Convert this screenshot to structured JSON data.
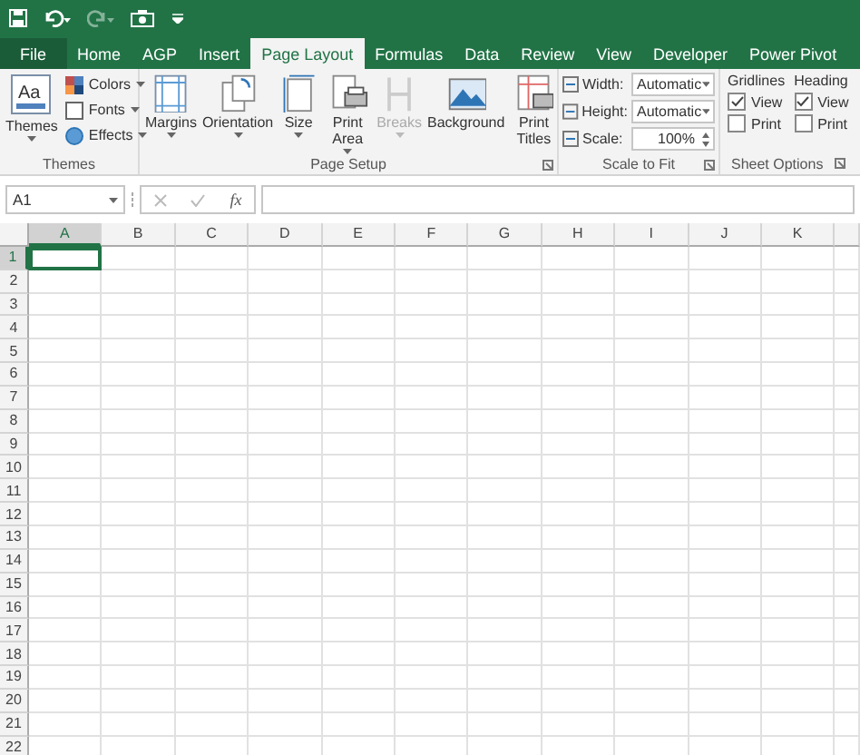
{
  "tabs": [
    {
      "label": "File",
      "kind": "file",
      "selected": false
    },
    {
      "label": "Home",
      "kind": "tab",
      "selected": false
    },
    {
      "label": "AGP",
      "kind": "tab",
      "selected": false
    },
    {
      "label": "Insert",
      "kind": "tab",
      "selected": false
    },
    {
      "label": "Page Layout",
      "kind": "tab",
      "selected": true
    },
    {
      "label": "Formulas",
      "kind": "tab",
      "selected": false
    },
    {
      "label": "Data",
      "kind": "tab",
      "selected": false
    },
    {
      "label": "Review",
      "kind": "tab",
      "selected": false
    },
    {
      "label": "View",
      "kind": "tab",
      "selected": false
    },
    {
      "label": "Developer",
      "kind": "tab",
      "selected": false
    },
    {
      "label": "Power Pivot",
      "kind": "tab",
      "selected": false
    }
  ],
  "themes_group": {
    "label": "Themes",
    "big_button": {
      "label": "Themes",
      "icon_text": "Aa"
    },
    "small_buttons": [
      {
        "label": "Colors"
      },
      {
        "label": "Fonts"
      },
      {
        "label": "Effects"
      }
    ]
  },
  "page_setup_group": {
    "label": "Page Setup",
    "buttons": [
      {
        "label": "Margins",
        "disabled": false,
        "dropdown": true,
        "wrap": false
      },
      {
        "label": "Orientation",
        "disabled": false,
        "dropdown": true,
        "wrap": false
      },
      {
        "label": "Size",
        "disabled": false,
        "dropdown": true,
        "wrap": false
      },
      {
        "label": "Print Area",
        "disabled": false,
        "dropdown": true,
        "wrap": true
      },
      {
        "label": "Breaks",
        "disabled": true,
        "dropdown": true,
        "wrap": false
      },
      {
        "label": "Background",
        "disabled": false,
        "dropdown": false,
        "wrap": false
      },
      {
        "label": "Print Titles",
        "disabled": false,
        "dropdown": false,
        "wrap": true
      }
    ]
  },
  "scale_to_fit_group": {
    "label": "Scale to Fit",
    "rows": [
      {
        "label": "Width:",
        "value": "Automatic",
        "kind": "dropdown"
      },
      {
        "label": "Height:",
        "value": "Automatic",
        "kind": "dropdown"
      },
      {
        "label": "Scale:",
        "value": "100%",
        "kind": "spinner"
      }
    ]
  },
  "sheet_options_group": {
    "label": "Sheet Options",
    "sections": [
      {
        "heading": "Gridlines",
        "options": [
          {
            "label": "View",
            "checked": true
          },
          {
            "label": "Print",
            "checked": false
          }
        ]
      },
      {
        "heading": "Heading",
        "options": [
          {
            "label": "View",
            "checked": true
          },
          {
            "label": "Print",
            "checked": false
          }
        ]
      }
    ]
  },
  "formula_bar": {
    "name_box": "A1",
    "function_label": "fx"
  },
  "grid": {
    "columns": [
      {
        "label": "A",
        "selected": true
      },
      {
        "label": "B",
        "selected": false
      },
      {
        "label": "C",
        "selected": false
      },
      {
        "label": "D",
        "selected": false
      },
      {
        "label": "E",
        "selected": false
      },
      {
        "label": "F",
        "selected": false
      },
      {
        "label": "G",
        "selected": false
      },
      {
        "label": "H",
        "selected": false
      },
      {
        "label": "I",
        "selected": false
      },
      {
        "label": "J",
        "selected": false
      },
      {
        "label": "K",
        "selected": false
      }
    ],
    "rows": [
      {
        "label": "1",
        "selected": true
      },
      {
        "label": "2",
        "selected": false
      },
      {
        "label": "3",
        "selected": false
      },
      {
        "label": "4",
        "selected": false
      },
      {
        "label": "5",
        "selected": false
      },
      {
        "label": "6",
        "selected": false
      },
      {
        "label": "7",
        "selected": false
      },
      {
        "label": "8",
        "selected": false
      },
      {
        "label": "9",
        "selected": false
      },
      {
        "label": "10",
        "selected": false
      },
      {
        "label": "11",
        "selected": false
      },
      {
        "label": "12",
        "selected": false
      },
      {
        "label": "13",
        "selected": false
      },
      {
        "label": "14",
        "selected": false
      },
      {
        "label": "15",
        "selected": false
      },
      {
        "label": "16",
        "selected": false
      },
      {
        "label": "17",
        "selected": false
      },
      {
        "label": "18",
        "selected": false
      },
      {
        "label": "19",
        "selected": false
      },
      {
        "label": "20",
        "selected": false
      },
      {
        "label": "21",
        "selected": false
      },
      {
        "label": "22",
        "selected": false
      }
    ]
  }
}
